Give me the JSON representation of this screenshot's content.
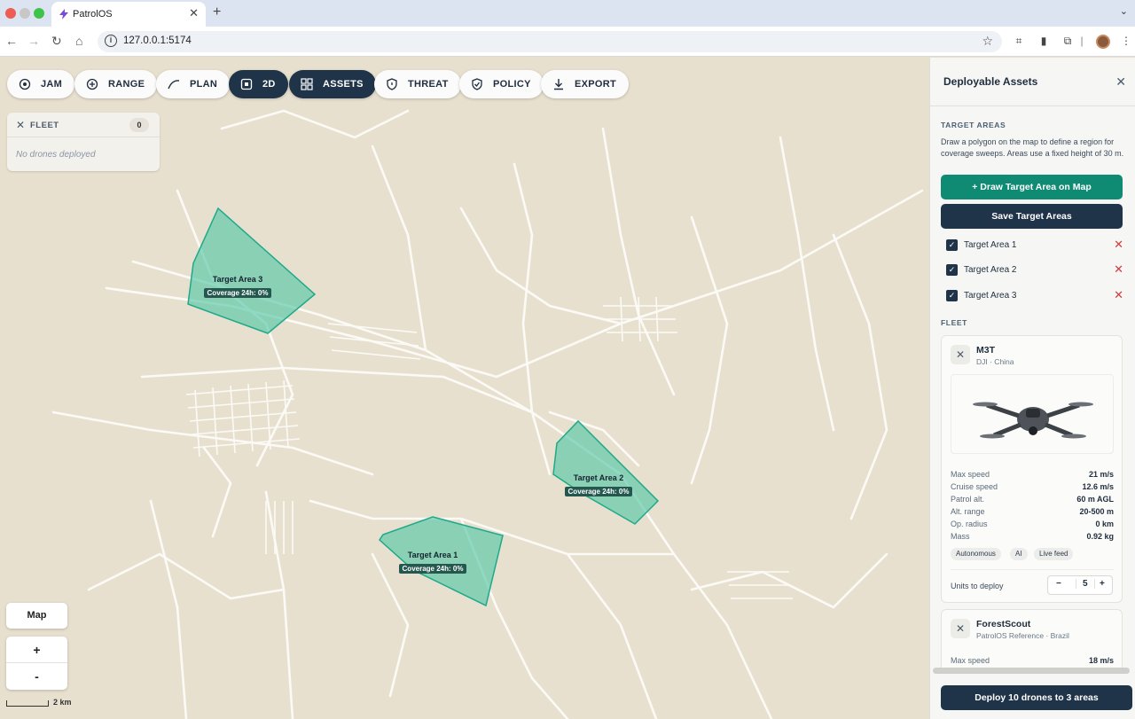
{
  "browser": {
    "tab_title": "PatrolOS",
    "url": "127.0.0.1:5174"
  },
  "toolbar_buttons": [
    {
      "label": "JAM",
      "icon": "target-icon"
    },
    {
      "label": "RANGE",
      "icon": "crosshair-icon"
    },
    {
      "label": "PLAN",
      "icon": "path-icon"
    },
    {
      "label": "2D",
      "icon": "square-icon"
    },
    {
      "label": "ASSETS",
      "icon": "grid-icon"
    },
    {
      "label": "THREAT",
      "icon": "shield-icon"
    },
    {
      "label": "POLICY",
      "icon": "check-shield-icon"
    },
    {
      "label": "EXPORT",
      "icon": "download-icon"
    }
  ],
  "fleet_box": {
    "label": "FLEET",
    "count": "0",
    "empty_text": "No drones deployed"
  },
  "map_controls": {
    "map_label": "Map",
    "zoom_in": "+",
    "zoom_out": "-",
    "scale_label": "2 km"
  },
  "target_areas_on_map": [
    {
      "name": "Target Area 3",
      "coverage": "Coverage 24h: 0%"
    },
    {
      "name": "Target Area 2",
      "coverage": "Coverage 24h: 0%"
    },
    {
      "name": "Target Area 1",
      "coverage": "Coverage 24h: 0%"
    }
  ],
  "panel": {
    "title": "Deployable Assets",
    "target_areas_heading": "TARGET AREAS",
    "description": "Draw a polygon on the map to define a region for coverage sweeps. Areas use a fixed height of 30 m.",
    "draw_button": "+ Draw Target Area on Map",
    "save_button": "Save Target Areas",
    "areas": [
      {
        "name": "Target Area 1",
        "checked": true
      },
      {
        "name": "Target Area 2",
        "checked": true
      },
      {
        "name": "Target Area 3",
        "checked": true
      }
    ],
    "fleet_heading": "FLEET",
    "drones": [
      {
        "name": "M3T",
        "origin": "DJI · China",
        "specs": [
          {
            "label": "Max speed",
            "value": "21 m/s"
          },
          {
            "label": "Cruise speed",
            "value": "12.6 m/s"
          },
          {
            "label": "Patrol alt.",
            "value": "60 m AGL"
          },
          {
            "label": "Alt. range",
            "value": "20-500 m"
          },
          {
            "label": "Op. radius",
            "value": "0 km"
          },
          {
            "label": "Mass",
            "value": "0.92 kg"
          }
        ],
        "tags": [
          "Autonomous",
          "AI",
          "Live feed"
        ],
        "units_label": "Units to deploy",
        "units": "5"
      },
      {
        "name": "ForestScout",
        "origin": "PatrolOS Reference · Brazil",
        "specs": [
          {
            "label": "Max speed",
            "value": "18 m/s"
          }
        ]
      }
    ],
    "deploy_button": "Deploy 10 drones to 3 areas"
  },
  "colors": {
    "accent_teal": "#0f8a73",
    "navy": "#1f3349",
    "area_fill": "#56c8a8",
    "danger": "#d13a3a"
  }
}
